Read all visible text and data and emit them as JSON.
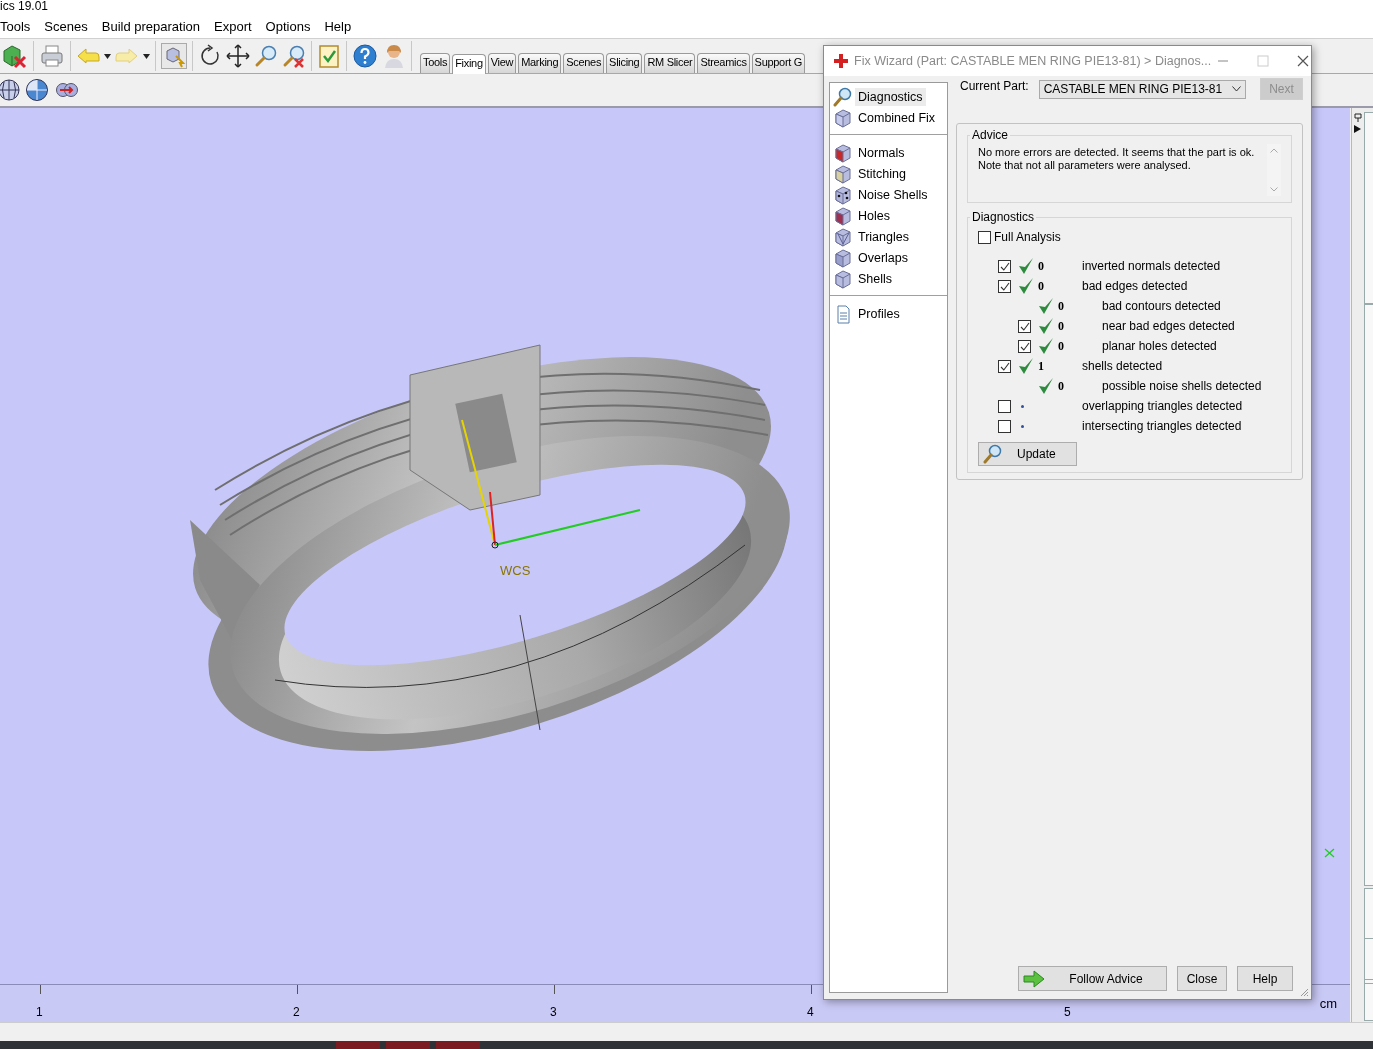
{
  "app_title": "ics 19.01",
  "menu": [
    "Tools",
    "Scenes",
    "Build preparation",
    "Export",
    "Options",
    "Help"
  ],
  "tabs": [
    {
      "label": "Tools",
      "selected": false
    },
    {
      "label": "Fixing",
      "selected": true
    },
    {
      "label": "View",
      "selected": false
    },
    {
      "label": "Marking",
      "selected": false
    },
    {
      "label": "Scenes",
      "selected": false
    },
    {
      "label": "Slicing",
      "selected": false
    },
    {
      "label": "RM Slicer",
      "selected": false
    },
    {
      "label": "Streamics",
      "selected": false
    },
    {
      "label": "Support G",
      "selected": false
    }
  ],
  "viewport": {
    "axis_label": "WCS",
    "ruler": {
      "ticks": [
        "1",
        "2",
        "3",
        "4",
        "5"
      ],
      "unit": "cm"
    }
  },
  "wizard": {
    "title": "Fix Wizard (Part: CASTABLE MEN RING PIE13-81) > Diagnos...",
    "sidebar": [
      [
        {
          "label": "Diagnostics",
          "selected": true
        },
        {
          "label": "Combined Fix",
          "selected": false
        }
      ],
      [
        {
          "label": "Normals",
          "selected": false
        },
        {
          "label": "Stitching",
          "selected": false
        },
        {
          "label": "Noise Shells",
          "selected": false
        },
        {
          "label": "Holes",
          "selected": false
        },
        {
          "label": "Triangles",
          "selected": false
        },
        {
          "label": "Overlaps",
          "selected": false
        },
        {
          "label": "Shells",
          "selected": false
        }
      ],
      [
        {
          "label": "Profiles",
          "selected": false
        }
      ]
    ],
    "current_part_label": "Current Part:",
    "current_part": "CASTABLE MEN RING PIE13-81",
    "next_button": {
      "label": "Next",
      "disabled": true
    },
    "advice": {
      "title": "Advice",
      "text": "No more errors are detected. It seems that the part is ok.\nNote that not all parameters were analysed."
    },
    "diagnostics": {
      "title": "Diagnostics",
      "full_analysis": {
        "label": "Full Analysis",
        "checked": false
      },
      "rows": [
        {
          "kind": "checkbox",
          "checked": true,
          "passed": true,
          "count": "0",
          "label": "inverted normals detected"
        },
        {
          "kind": "checkbox",
          "checked": true,
          "passed": true,
          "count": "0",
          "label": "bad edges detected",
          "children": [
            {
              "kind": "plain",
              "passed": true,
              "count": "0",
              "label": "bad contours detected"
            },
            {
              "kind": "checkbox",
              "checked": true,
              "passed": true,
              "count": "0",
              "label": "near bad edges detected"
            },
            {
              "kind": "checkbox",
              "checked": true,
              "passed": true,
              "count": "0",
              "label": "planar holes detected"
            }
          ]
        },
        {
          "kind": "checkbox",
          "checked": true,
          "passed": true,
          "count": "1",
          "label": "shells detected",
          "children": [
            {
              "kind": "plain",
              "passed": true,
              "count": "0",
              "label": "possible noise shells detected"
            }
          ]
        },
        {
          "kind": "checkbox",
          "checked": false,
          "passed": false,
          "label": "overlapping triangles detected"
        },
        {
          "kind": "checkbox",
          "checked": false,
          "passed": false,
          "label": "intersecting triangles detected"
        }
      ],
      "update_button": "Update"
    },
    "buttons": [
      "Follow Advice",
      "Close",
      "Help"
    ]
  }
}
